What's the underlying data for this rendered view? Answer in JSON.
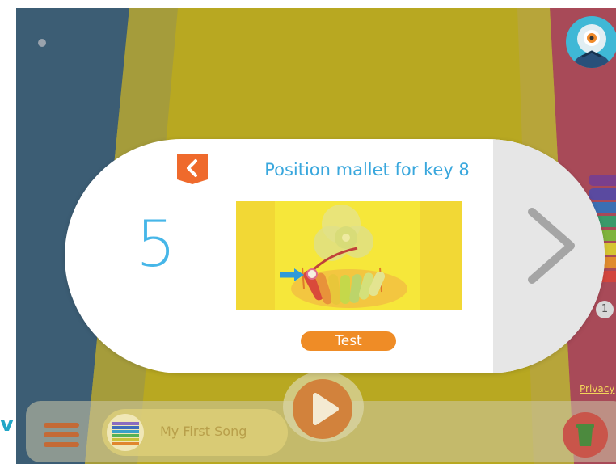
{
  "header": {
    "avatar_icon": "robot-avatar-icon"
  },
  "modal": {
    "step_number": "5",
    "title": "Position mallet for key 8",
    "test_label": "Test",
    "back_icon": "chevron-left-icon",
    "next_icon": "chevron-right-icon",
    "illustration": "mallet-xylophone-illustration"
  },
  "side": {
    "privacy_label": "Privacy",
    "page_count": "1"
  },
  "bottom": {
    "song_title": "My First Song",
    "menu_icon": "hamburger-menu-icon",
    "play_icon": "play-icon",
    "trash_icon": "trash-icon"
  },
  "colors": {
    "accent_blue": "#39a7dd",
    "accent_orange": "#ef8c26",
    "background_yellow": "#b8a821"
  }
}
